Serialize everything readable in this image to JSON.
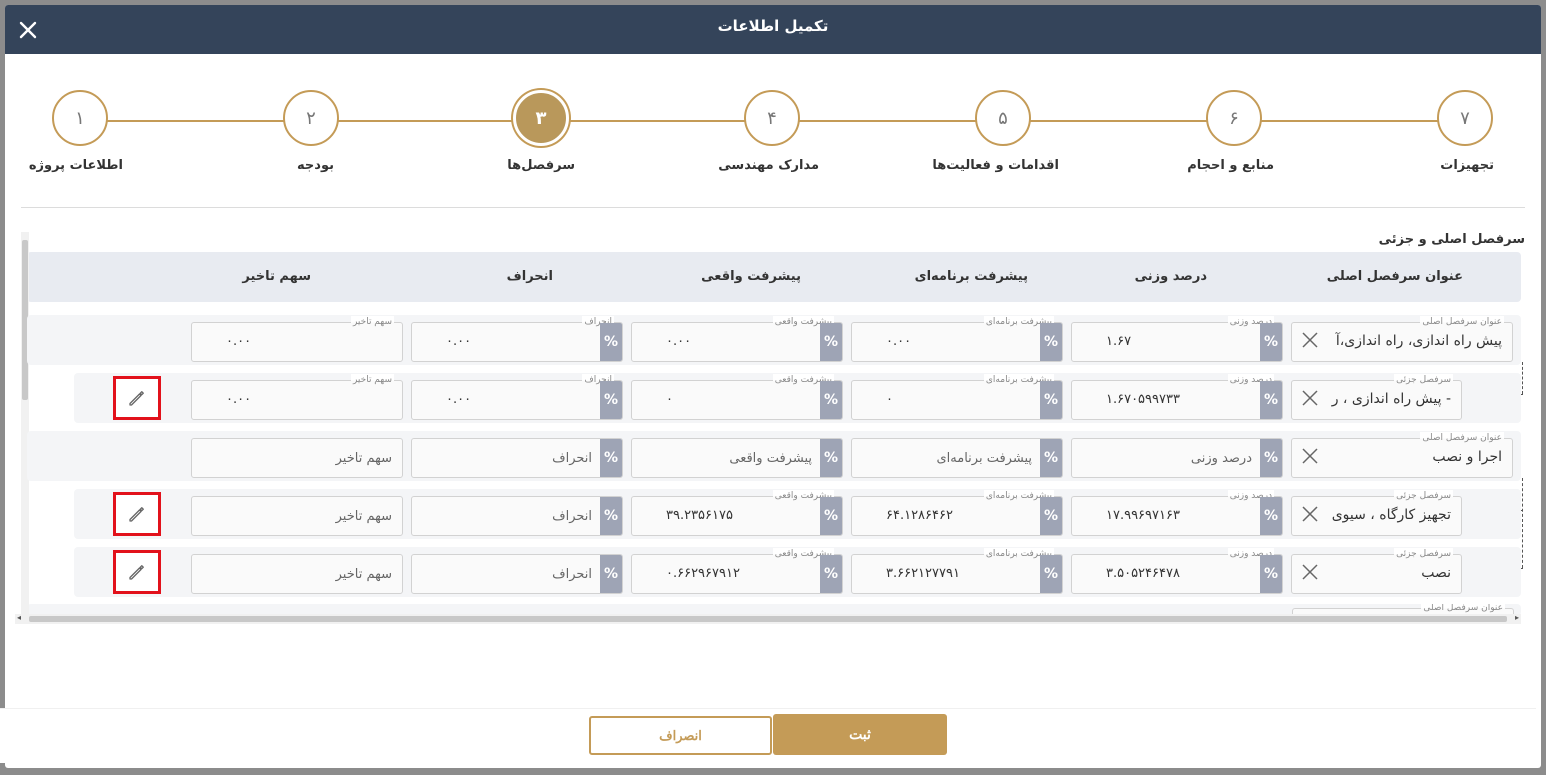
{
  "modal": {
    "title": "تکمیل اطلاعات"
  },
  "steps": [
    {
      "num": "۷",
      "label": "تجهیزات"
    },
    {
      "num": "۶",
      "label": "منابع و احجام"
    },
    {
      "num": "۵",
      "label": "اقدامات و فعالیت‌ها"
    },
    {
      "num": "۴",
      "label": "مدارک مهندسی"
    },
    {
      "num": "۳",
      "label": "سرفصل‌ها"
    },
    {
      "num": "۲",
      "label": "بودجه"
    },
    {
      "num": "۱",
      "label": "اطلاعات پروژه"
    }
  ],
  "active_step": "۳",
  "section_title": "سرفصل اصلی و جزئی",
  "columns": {
    "title": "عنوان سرفصل اصلی",
    "weight": "درصد وزنی",
    "planned": "پیشرفت برنامه‌ای",
    "actual": "پیشرفت واقعی",
    "deviation": "انحراف",
    "delay": "سهم تاخیر"
  },
  "field_labels": {
    "main_title": "عنوان سرفصل اصلی",
    "sub_title": "سرفصل جزئی",
    "weight": "درصد وزنی",
    "planned": "پیشرفت برنامه‌ای",
    "actual": "پیشرفت واقعی",
    "deviation": "انحراف",
    "delay": "سهم تاخیر"
  },
  "placeholders": {
    "weight": "درصد وزنی",
    "planned": "پیشرفت برنامه‌ای",
    "actual": "پیشرفت واقعی",
    "deviation": "انحراف",
    "delay": "سهم تاخیر"
  },
  "rows": [
    {
      "type": "main",
      "title": "پیش راه اندازی، راه اندازی،آ",
      "weight": "۱.۶۷",
      "planned": "۰.۰۰",
      "actual": "۰.۰۰",
      "deviation": "۰.۰۰",
      "delay": "۰.۰۰"
    },
    {
      "type": "sub",
      "title": "- پیش راه اندازی ، ر",
      "weight": "۱.۶۷۰۵۹۹۷۳۳",
      "planned": "۰",
      "actual": "۰",
      "deviation": "۰.۰۰",
      "delay": "۰.۰۰"
    },
    {
      "type": "main",
      "title": "اجرا و نصب"
    },
    {
      "type": "sub",
      "title": "تجهیز کارگاه ، سیوی",
      "weight": "۱۷.۹۹۶۹۷۱۶۳",
      "planned": "۶۴.۱۲۸۶۴۶۲",
      "actual": "۳۹.۲۳۵۶۱۷۵"
    },
    {
      "type": "sub",
      "title": "نصب",
      "weight": "۳.۵۰۵۲۴۶۴۷۸",
      "planned": "۳.۶۶۲۱۲۷۷۹۱",
      "actual": "۰.۶۶۲۹۶۷۹۱۲"
    }
  ],
  "pct_symbol": "%",
  "buttons": {
    "submit": "ثبت",
    "cancel": "انصراف"
  }
}
